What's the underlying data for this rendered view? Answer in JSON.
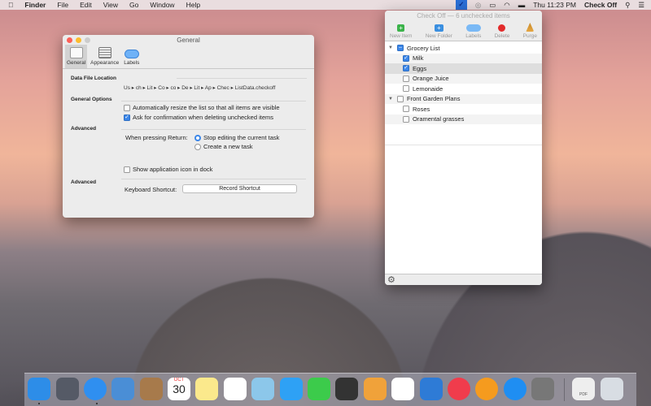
{
  "menubar": {
    "app": "Finder",
    "items": [
      "File",
      "Edit",
      "View",
      "Go",
      "Window",
      "Help"
    ],
    "clock": "Thu 11:23 PM",
    "app_right": "Check Off"
  },
  "general": {
    "title": "General",
    "tabs": [
      "General",
      "Appearance",
      "Labels"
    ],
    "data_file_location": "Data File Location",
    "path": "Us ▸ ch ▸ Lit ▸ Co ▸ co ▸ De ▸ Lit ▸ Ap ▸ Chec ▸ ListData.checkoff",
    "general_options": "General Options",
    "opt_resize": "Automatically resize the list so that all items are visible",
    "opt_resize_checked": false,
    "opt_confirm": "Ask for confirmation when deleting unchecked items",
    "opt_confirm_checked": true,
    "advanced1": "Advanced",
    "return_label": "When pressing Return:",
    "radio_stop": "Stop editing the current task",
    "radio_new": "Create a new task",
    "radio_selected": "Stop editing the current task",
    "opt_dock": "Show application icon in dock",
    "opt_dock_checked": false,
    "advanced2": "Advanced",
    "shortcut_label": "Keyboard Shortcut:",
    "shortcut_button": "Record Shortcut"
  },
  "checkoff": {
    "title": "Check Off — 6 unchecked items",
    "toolbar": [
      "New Item",
      "New Folder",
      "Labels",
      "Delete",
      "Purge"
    ],
    "items": [
      {
        "label": "Grocery List",
        "folder": true,
        "state": "mixed"
      },
      {
        "label": "Milk",
        "checked": true
      },
      {
        "label": "Eggs",
        "checked": true,
        "selected": true
      },
      {
        "label": "Orange Juice",
        "checked": false
      },
      {
        "label": "Lemonaide",
        "checked": false
      },
      {
        "label": "Front Garden Plans",
        "folder": true,
        "state": "unchecked"
      },
      {
        "label": "Roses",
        "checked": false
      },
      {
        "label": "Oramental grasses",
        "checked": false
      }
    ]
  },
  "dock": {
    "apps": [
      "Finder",
      "Launchpad",
      "Safari",
      "Mail",
      "Contacts",
      "Calendar",
      "Notes",
      "Reminders",
      "Maps",
      "Messages",
      "FaceTime",
      "Photo Booth",
      "Pages",
      "Numbers",
      "Keynote",
      "iTunes",
      "iBooks",
      "App Store",
      "System Preferences",
      "PDF",
      "Trash"
    ],
    "calendar_month": "OCT",
    "calendar_day": "30",
    "pdf_label": "PDF"
  },
  "colors": {
    "accent": "#3b86e8"
  }
}
